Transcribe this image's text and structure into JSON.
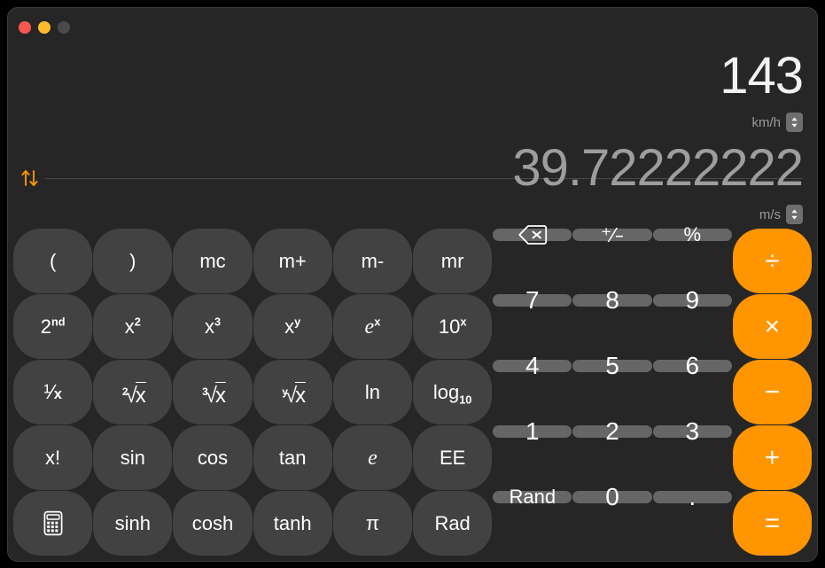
{
  "window": {
    "traffic_lights": [
      {
        "name": "close",
        "color": "#f9574e"
      },
      {
        "name": "minimize",
        "color": "#fcbb2c"
      },
      {
        "name": "zoom",
        "color": "#4a4a4a"
      }
    ]
  },
  "display": {
    "top": {
      "value": "143",
      "unit": "km/h"
    },
    "bottom": {
      "value": "39.72222222",
      "unit": "m/s"
    },
    "swap_icon": "swap-arrows-icon"
  },
  "theme": {
    "accent": "#ff9500",
    "key_dark": "#424242",
    "key_light": "#666666",
    "window_bg": "#262626",
    "text_primary": "#f2f2f2",
    "text_secondary": "#9d9d9d"
  },
  "keypad": {
    "rows": [
      [
        {
          "label": "(",
          "name": "paren-open-key",
          "style": "dark"
        },
        {
          "label": ")",
          "name": "paren-close-key",
          "style": "dark"
        },
        {
          "label": "mc",
          "name": "memory-clear-key",
          "style": "dark"
        },
        {
          "label": "m+",
          "name": "memory-add-key",
          "style": "dark"
        },
        {
          "label": "m-",
          "name": "memory-sub-key",
          "style": "dark"
        },
        {
          "label": "mr",
          "name": "memory-recall-key",
          "style": "dark"
        },
        {
          "label": "",
          "name": "backspace-key",
          "style": "light",
          "icon": "backspace-icon"
        },
        {
          "label": "+/-",
          "name": "sign-toggle-key",
          "style": "light",
          "glyph": "plus-minus"
        },
        {
          "label": "%",
          "name": "percent-key",
          "style": "light"
        },
        {
          "label": "÷",
          "name": "divide-key",
          "style": "accent"
        }
      ],
      [
        {
          "label": "2nd",
          "name": "second-function-key",
          "style": "dark",
          "glyph": "2nd"
        },
        {
          "label": "x²",
          "name": "square-key",
          "style": "dark",
          "glyph": "x2"
        },
        {
          "label": "x³",
          "name": "cube-key",
          "style": "dark",
          "glyph": "x3"
        },
        {
          "label": "xʸ",
          "name": "power-y-key",
          "style": "dark",
          "glyph": "xy"
        },
        {
          "label": "eˣ",
          "name": "exp-e-key",
          "style": "dark",
          "glyph": "ex"
        },
        {
          "label": "10ˣ",
          "name": "exp-ten-key",
          "style": "dark",
          "glyph": "10x"
        },
        {
          "label": "7",
          "name": "digit-7-key",
          "style": "light",
          "digit": true
        },
        {
          "label": "8",
          "name": "digit-8-key",
          "style": "light",
          "digit": true
        },
        {
          "label": "9",
          "name": "digit-9-key",
          "style": "light",
          "digit": true
        },
        {
          "label": "×",
          "name": "multiply-key",
          "style": "accent"
        }
      ],
      [
        {
          "label": "1/x",
          "name": "reciprocal-key",
          "style": "dark",
          "glyph": "1/x"
        },
        {
          "label": "²√x",
          "name": "square-root-key",
          "style": "dark",
          "glyph": "root2"
        },
        {
          "label": "³√x",
          "name": "cube-root-key",
          "style": "dark",
          "glyph": "root3"
        },
        {
          "label": "ʸ√x",
          "name": "nth-root-key",
          "style": "dark",
          "glyph": "rooty"
        },
        {
          "label": "ln",
          "name": "natural-log-key",
          "style": "dark"
        },
        {
          "label": "log10",
          "name": "log-base-ten-key",
          "style": "dark",
          "glyph": "log10"
        },
        {
          "label": "4",
          "name": "digit-4-key",
          "style": "light",
          "digit": true
        },
        {
          "label": "5",
          "name": "digit-5-key",
          "style": "light",
          "digit": true
        },
        {
          "label": "6",
          "name": "digit-6-key",
          "style": "light",
          "digit": true
        },
        {
          "label": "−",
          "name": "subtract-key",
          "style": "accent"
        }
      ],
      [
        {
          "label": "x!",
          "name": "factorial-key",
          "style": "dark"
        },
        {
          "label": "sin",
          "name": "sine-key",
          "style": "dark"
        },
        {
          "label": "cos",
          "name": "cosine-key",
          "style": "dark"
        },
        {
          "label": "tan",
          "name": "tangent-key",
          "style": "dark"
        },
        {
          "label": "e",
          "name": "euler-e-key",
          "style": "dark",
          "glyph": "e"
        },
        {
          "label": "EE",
          "name": "ee-key",
          "style": "dark"
        },
        {
          "label": "1",
          "name": "digit-1-key",
          "style": "light",
          "digit": true
        },
        {
          "label": "2",
          "name": "digit-2-key",
          "style": "light",
          "digit": true
        },
        {
          "label": "3",
          "name": "digit-3-key",
          "style": "light",
          "digit": true
        },
        {
          "label": "+",
          "name": "add-key",
          "style": "accent"
        }
      ],
      [
        {
          "label": "",
          "name": "calculator-mode-key",
          "style": "dark",
          "icon": "calculator-icon"
        },
        {
          "label": "sinh",
          "name": "hyperbolic-sine-key",
          "style": "dark"
        },
        {
          "label": "cosh",
          "name": "hyperbolic-cosine-key",
          "style": "dark"
        },
        {
          "label": "tanh",
          "name": "hyperbolic-tangent-key",
          "style": "dark"
        },
        {
          "label": "π",
          "name": "pi-key",
          "style": "dark"
        },
        {
          "label": "Rad",
          "name": "radians-key",
          "style": "dark"
        },
        {
          "label": "Rand",
          "name": "random-key",
          "style": "light"
        },
        {
          "label": "0",
          "name": "digit-0-key",
          "style": "light",
          "digit": true
        },
        {
          "label": ".",
          "name": "decimal-point-key",
          "style": "light",
          "digit": true
        },
        {
          "label": "=",
          "name": "equals-key",
          "style": "accent"
        }
      ]
    ]
  }
}
